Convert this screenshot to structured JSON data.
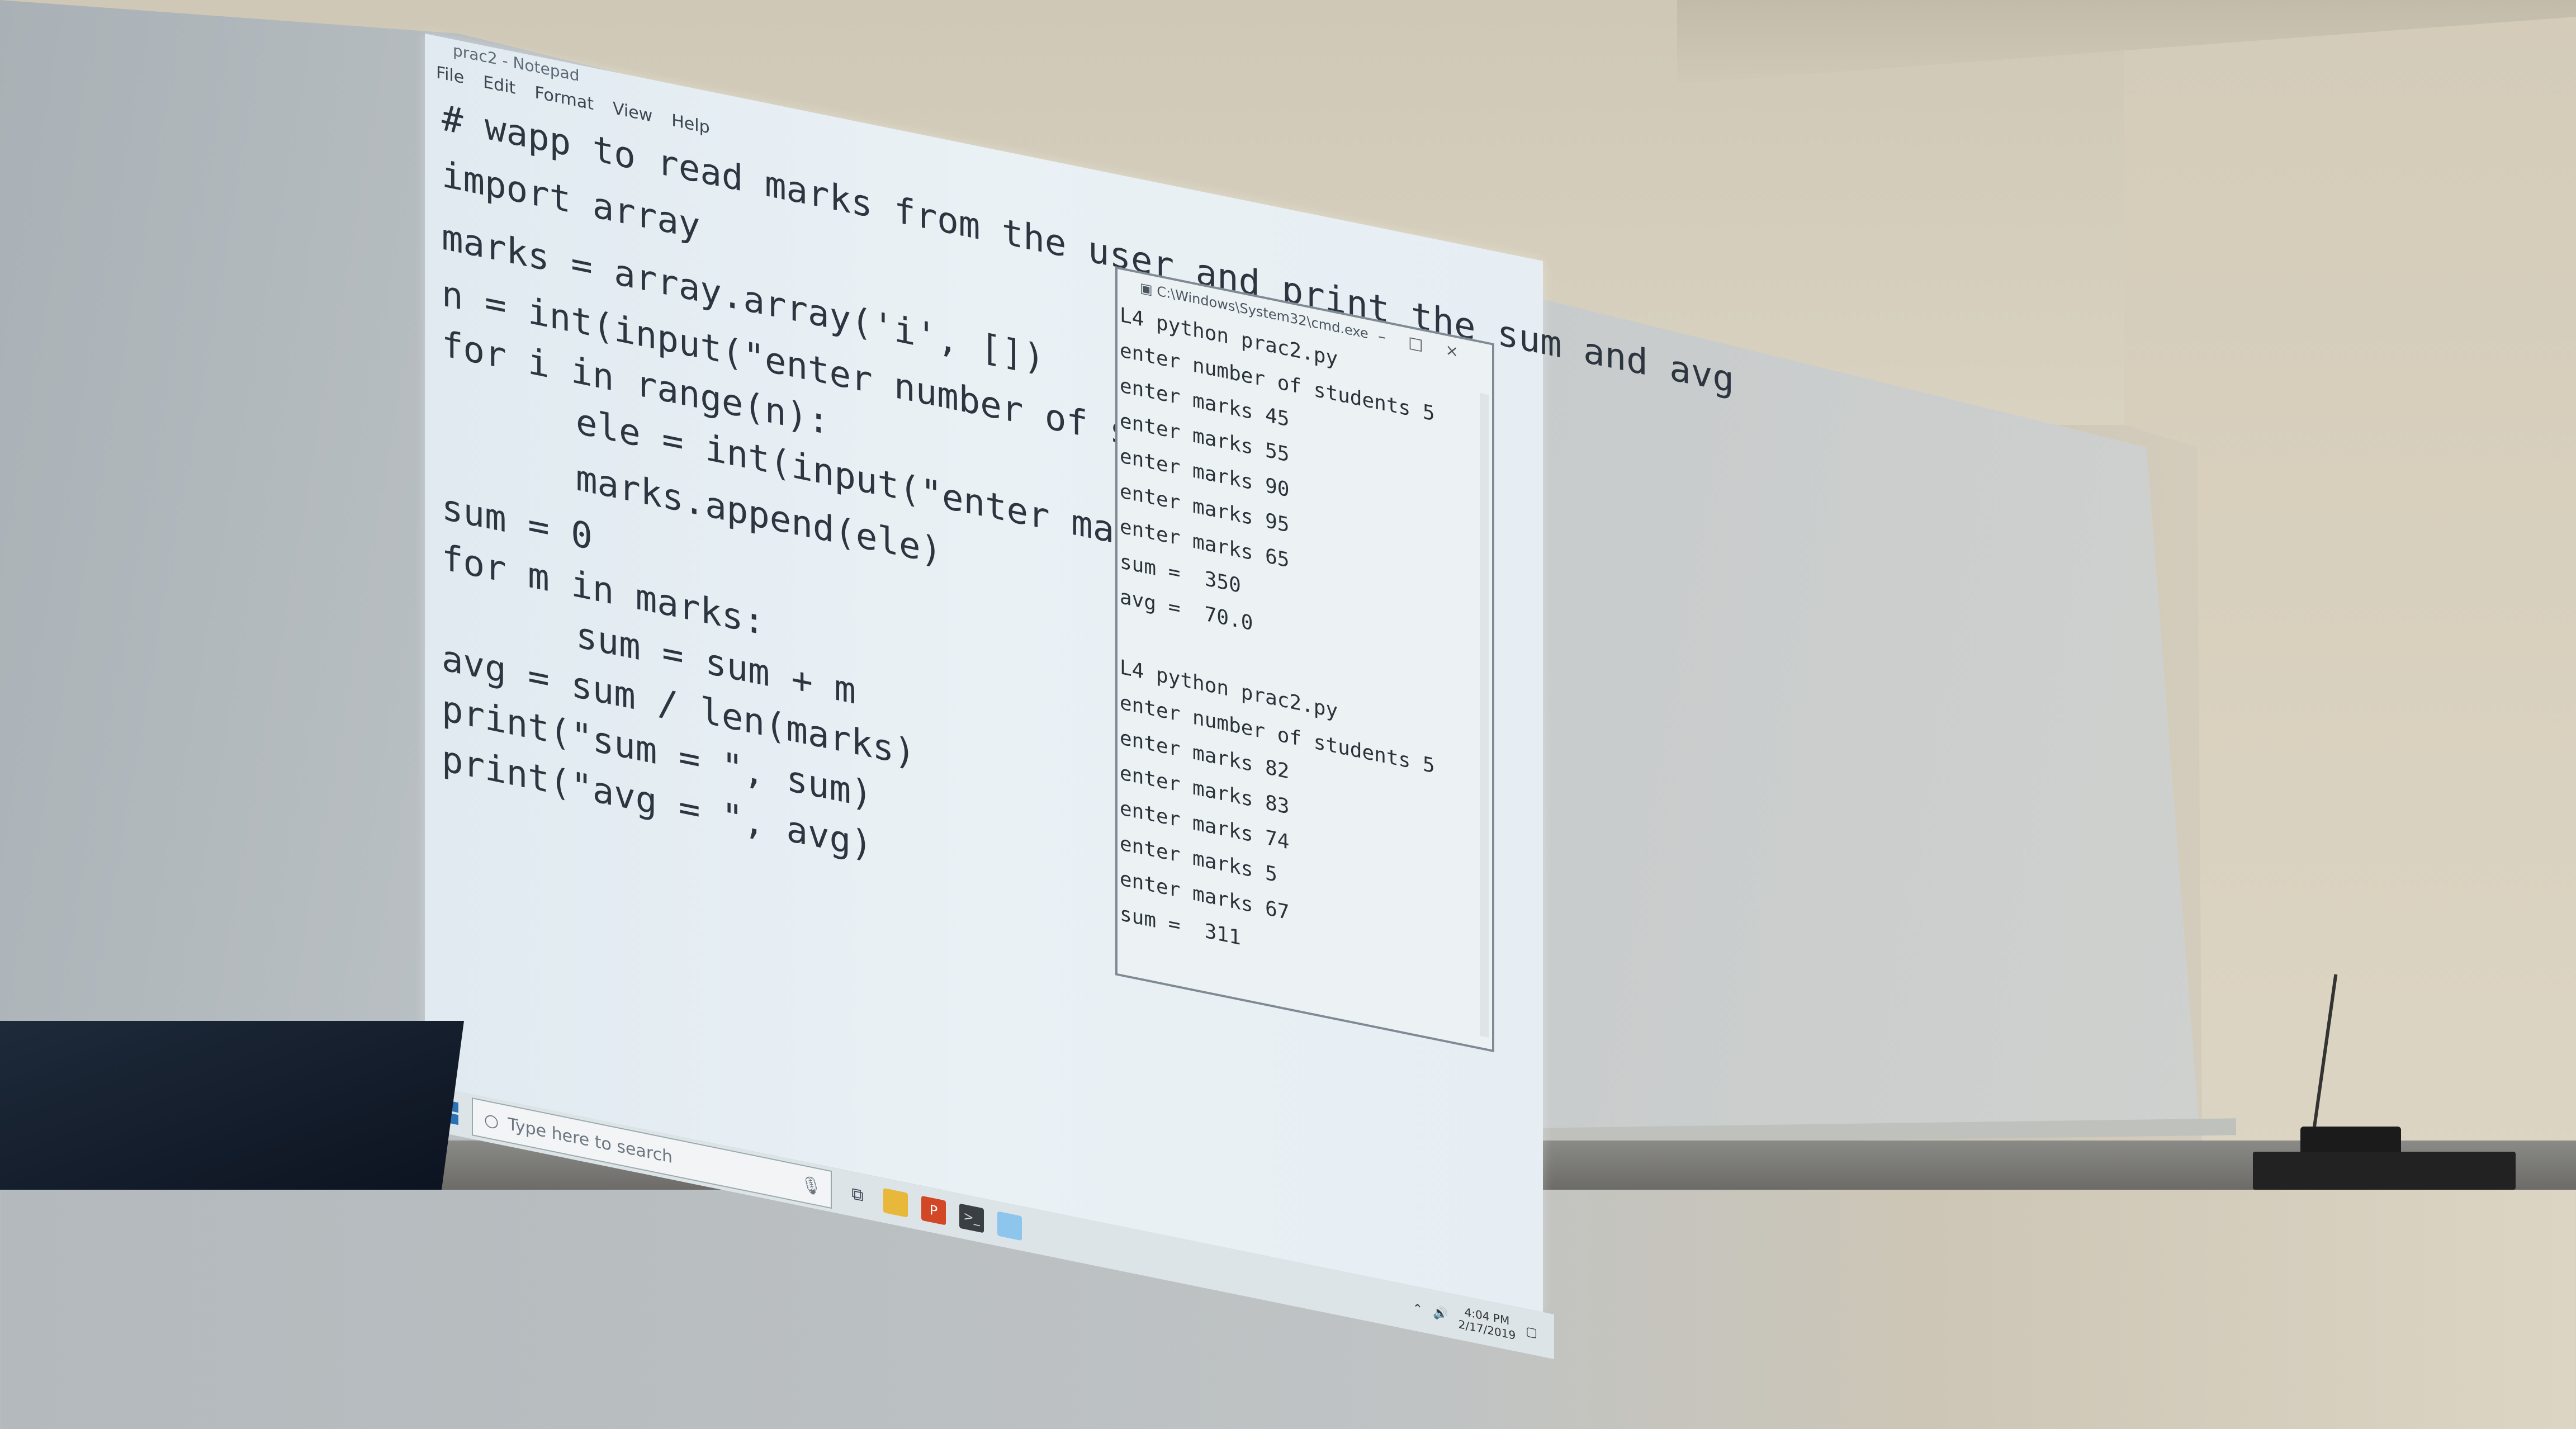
{
  "window": {
    "title": "prac2 - Notepad",
    "menu": [
      "File",
      "Edit",
      "Format",
      "View",
      "Help"
    ]
  },
  "code_lines": [
    "# wapp to read marks from the user and print the sum and avg",
    "import array",
    "marks = array.array('i', [])",
    "n = int(input(\"enter number of students \"))",
    "for i in range(n):",
    "ele = int(input(\"enter marks \"))",
    "marks.append(ele)",
    "sum = 0",
    "for m in marks:",
    "sum = sum + m",
    "avg = sum / len(marks)",
    "print(\"sum = \", sum)",
    "print(\"avg = \", avg)"
  ],
  "cmd": {
    "title": "C:\\Windows\\System32\\cmd.exe",
    "controls": [
      "–",
      "□",
      "×"
    ],
    "lines": [
      "L4 python prac2.py",
      "enter number of students 5",
      "enter marks 45",
      "enter marks 55",
      "enter marks 90",
      "enter marks 95",
      "enter marks 65",
      "sum =  350",
      "avg =  70.0",
      "",
      "L4 python prac2.py",
      "enter number of students 5",
      "enter marks 82",
      "enter marks 83",
      "enter marks 74",
      "enter marks 5",
      "enter marks 67",
      "sum =  311"
    ]
  },
  "taskbar": {
    "search_placeholder": "Type here to search",
    "time": "4:04 PM",
    "date": "2/17/2019"
  },
  "icons": {
    "start": "windows-icon",
    "search": "search-icon",
    "mic": "microphone-icon",
    "taskview": "task-view-icon",
    "explorer": "folder-icon",
    "powerpoint": "powerpoint-icon",
    "cmd": "terminal-icon",
    "notepad": "notepad-icon"
  },
  "colors": {
    "projection_bg": "#e6eef3",
    "code_text": "#2d3640",
    "accent": "#2b6fb5"
  }
}
